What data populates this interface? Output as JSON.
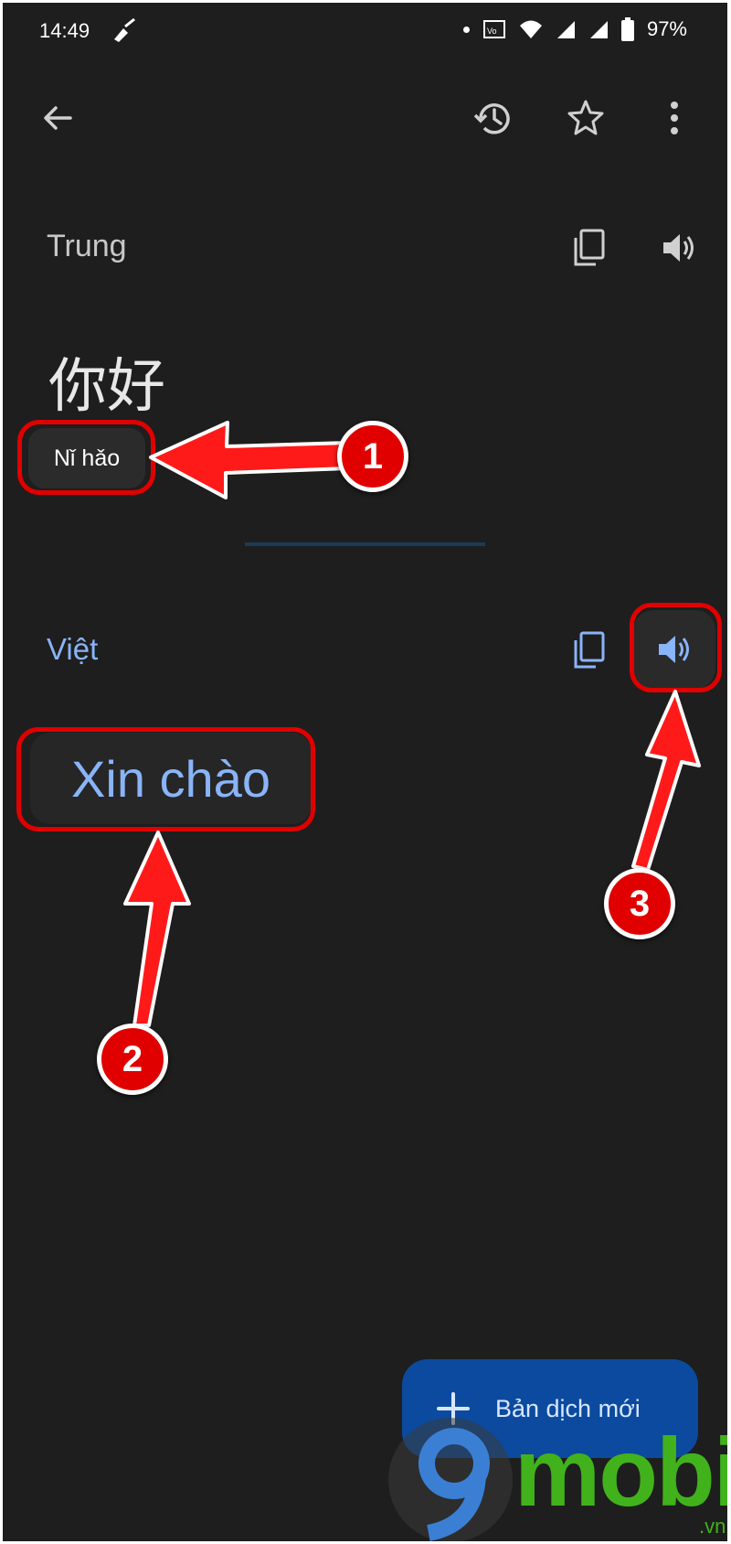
{
  "status_bar": {
    "time": "14:49",
    "battery": "97%"
  },
  "app_bar": {
    "icons": [
      "back-arrow-icon",
      "history-icon",
      "star-icon",
      "more-vert-icon"
    ]
  },
  "source": {
    "language": "Trung",
    "text": "你好",
    "romanization": "Nǐ hǎo"
  },
  "target": {
    "language": "Việt",
    "text": "Xin chào"
  },
  "fab": {
    "label": "Bản dịch mới"
  },
  "annotations": [
    "1",
    "2",
    "3"
  ],
  "watermark": {
    "brand": "mobi",
    "suffix": ".vn"
  },
  "colors": {
    "background": "#1e1e1e",
    "accent_blue": "#8ab4f8",
    "fab": "#0b4a9e",
    "annotation_red": "#e00000",
    "watermark_green": "#41b21b"
  }
}
